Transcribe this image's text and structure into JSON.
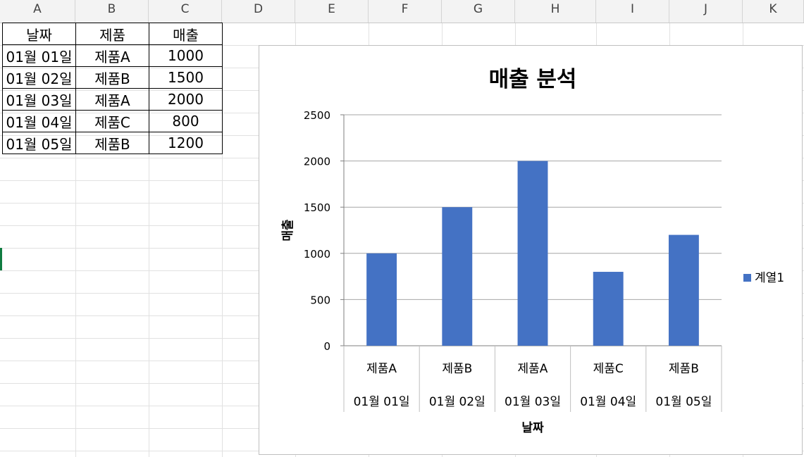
{
  "sheet": {
    "columns": [
      "A",
      "B",
      "C",
      "D",
      "E",
      "F",
      "G",
      "H",
      "I",
      "J",
      "K"
    ],
    "header": [
      "날짜",
      "제품",
      "매출"
    ],
    "rows": [
      [
        "01월 01일",
        "제품A",
        "1000"
      ],
      [
        "01월 02일",
        "제품B",
        "1500"
      ],
      [
        "01월 03일",
        "제품A",
        "2000"
      ],
      [
        "01월 04일",
        "제품C",
        "800"
      ],
      [
        "01월 05일",
        "제품B",
        "1200"
      ]
    ]
  },
  "chart_data": {
    "type": "bar",
    "title": "매출 분석",
    "xlabel": "날짜",
    "ylabel": "매출",
    "categories": [
      [
        "제품A",
        "01월 01일"
      ],
      [
        "제품B",
        "01월 02일"
      ],
      [
        "제품A",
        "01월 03일"
      ],
      [
        "제품C",
        "01월 04일"
      ],
      [
        "제품B",
        "01월 05일"
      ]
    ],
    "series": [
      {
        "name": "계열1",
        "values": [
          1000,
          1500,
          2000,
          800,
          1200
        ],
        "color": "#4472c4"
      }
    ],
    "ylim": [
      0,
      2500
    ],
    "yticks": [
      0,
      500,
      1000,
      1500,
      2000,
      2500
    ],
    "grid": true,
    "legend": "right"
  }
}
